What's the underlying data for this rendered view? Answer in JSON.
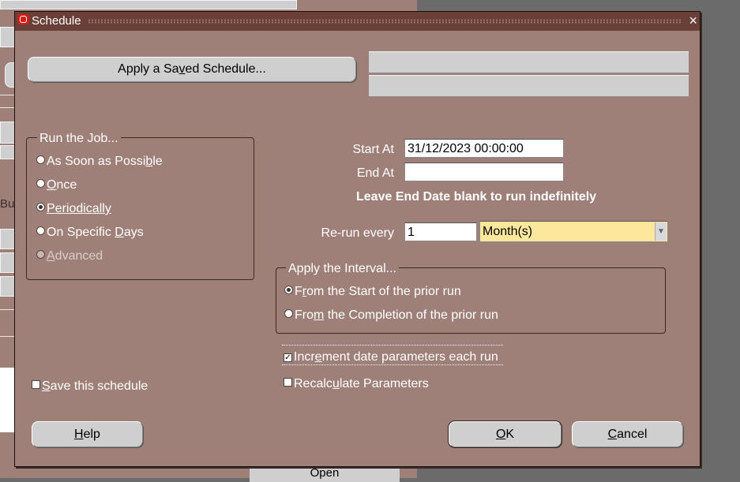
{
  "dialog": {
    "title": "Schedule",
    "close_glyph": "×"
  },
  "saved_schedule_button": {
    "before": "Apply a Sa",
    "mnemonic": "v",
    "after": "ed Schedule..."
  },
  "run_job": {
    "label": "Run the Job...",
    "options": [
      {
        "before": "As Soon as Possi",
        "mnemonic": "b",
        "after": "le",
        "selected": false,
        "enabled": true
      },
      {
        "before": "",
        "mnemonic": "O",
        "after": "nce",
        "selected": false,
        "enabled": true
      },
      {
        "before": "",
        "mnemonic": "P",
        "after": "eriodically",
        "selected": true,
        "enabled": true
      },
      {
        "before": "On Specific ",
        "mnemonic": "D",
        "after": "ays",
        "selected": false,
        "enabled": true
      },
      {
        "before": "",
        "mnemonic": "A",
        "after": "dvanced",
        "selected": false,
        "enabled": false
      }
    ]
  },
  "start_at": {
    "label": "Start At",
    "value": "31/12/2023 00:00:00"
  },
  "end_at": {
    "label": "End At",
    "value": ""
  },
  "end_note": "Leave End Date blank to run indefinitely",
  "rerun": {
    "label": "Re-run every",
    "value": "1",
    "unit": "Month(s)"
  },
  "interval": {
    "label": "Apply the Interval...",
    "options": [
      {
        "before": "F",
        "mnemonic": "r",
        "after": "om the Start of the prior run",
        "selected": true
      },
      {
        "before": "Fro",
        "mnemonic": "m",
        "after": " the Completion of the prior run",
        "selected": false
      }
    ]
  },
  "increment": {
    "before": "Incr",
    "mnemonic": "e",
    "after": "ment date parameters each run",
    "checked": true
  },
  "recalculate": {
    "before": "Recalc",
    "mnemonic": "u",
    "after": "late Parameters",
    "checked": false
  },
  "save_schedule": {
    "before": "",
    "mnemonic": "S",
    "after": "ave this schedule",
    "checked": false
  },
  "buttons": {
    "help": {
      "mnemonic": "H",
      "after": "elp"
    },
    "ok": {
      "mnemonic": "O",
      "after": "K"
    },
    "cancel": {
      "mnemonic": "C",
      "after": "ancel"
    }
  },
  "background": {
    "open_label": "Open",
    "partial_label": "Bu"
  },
  "colors": {
    "dialog_bg": "#9e8079",
    "title_bg": "#6a3f37",
    "select_bg": "#fde79c",
    "button_bg": "#cfcfcf"
  }
}
